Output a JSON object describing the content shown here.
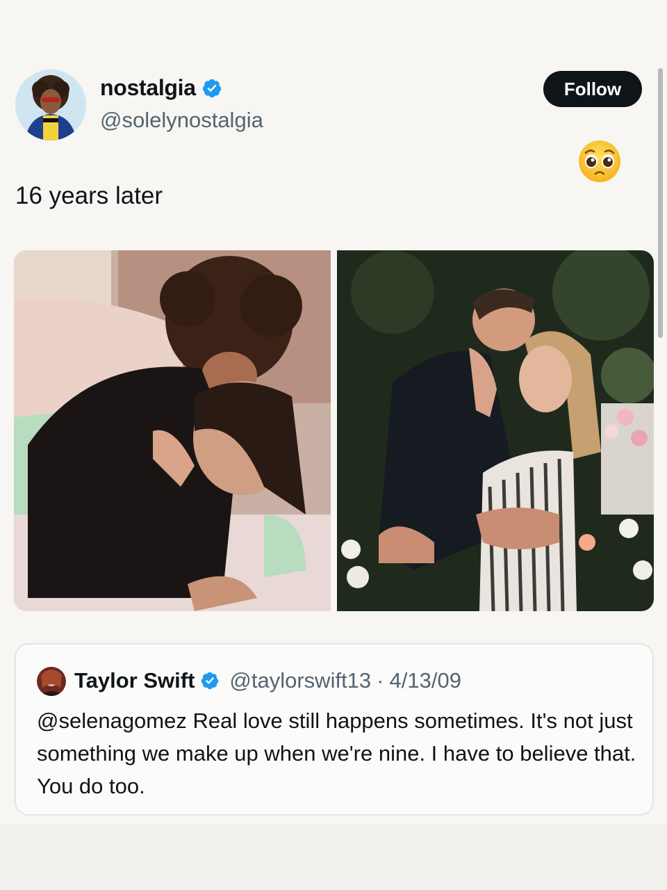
{
  "post": {
    "author": {
      "display_name": "nostalgia",
      "handle": "@solelynostalgia",
      "verified": true
    },
    "follow_label": "Follow",
    "reaction_emoji": "pleading-face-emoji",
    "text": "16 years later",
    "media": [
      {
        "alt": "couple-photo-left"
      },
      {
        "alt": "couple-photo-right"
      }
    ]
  },
  "quote": {
    "author": {
      "display_name": "Taylor Swift",
      "handle": "@taylorswift13",
      "verified": true
    },
    "separator": "·",
    "date": "4/13/09",
    "text": "@selenagomez Real love still happens sometimes. It's not just something we make up when we're nine. I have to believe that. You do too."
  },
  "colors": {
    "verified_blue": "#1d9bf0",
    "button_bg": "#0f1419",
    "secondary_text": "#536471"
  }
}
